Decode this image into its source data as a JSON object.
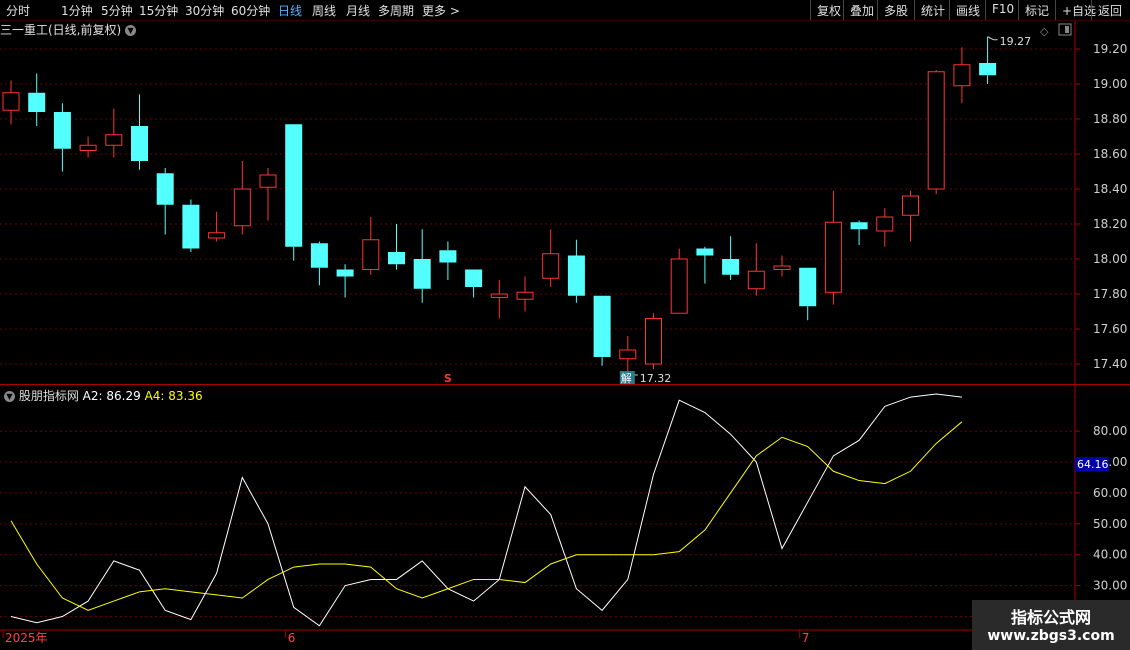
{
  "toolbar": {
    "periods": [
      "分时",
      "1分钟",
      "5分钟",
      "15分钟",
      "30分钟",
      "60分钟",
      "日线",
      "周线",
      "月线",
      "多周期",
      "更多 >"
    ],
    "active_period": "日线",
    "right_buttons": [
      "复权",
      "叠加",
      "多股",
      "统计",
      "画线",
      "F10",
      "标记",
      "+自选",
      "返回"
    ]
  },
  "main_chart": {
    "stock_title": "三一重工(日线,前复权)",
    "toggle_icon": "chevron-down-icon"
  },
  "indicator": {
    "title": "股朋指标网",
    "a2_label": "A2: 86.29",
    "a4_label": "A4: 83.36",
    "current_value_tag": "64.16"
  },
  "watermark": {
    "line1": "指标公式网",
    "line2": "www.zbgs3.com"
  },
  "colors": {
    "up": "#ff3232",
    "down": "#54ffff",
    "grid": "#6a0000",
    "axis": "#aa0000",
    "a2": "#ffffff",
    "a4": "#ffff00",
    "tag_bg": "#0000aa"
  },
  "chart_data": [
    {
      "type": "candlestick",
      "ylim": [
        17.28,
        19.36
      ],
      "yticks": [
        "19.20",
        "19.00",
        "18.80",
        "18.60",
        "18.40",
        "18.20",
        "18.00",
        "17.80",
        "17.60",
        "17.40"
      ],
      "annotations": [
        {
          "text": "19.27",
          "label": "high"
        },
        {
          "text": "17.32",
          "label": "low"
        },
        {
          "text": "S",
          "label": "sell-signal"
        },
        {
          "text": "解",
          "label": "unlock-marker"
        }
      ],
      "candles": [
        {
          "o": 18.85,
          "h": 19.02,
          "l": 18.77,
          "c": 18.95
        },
        {
          "o": 18.95,
          "h": 19.06,
          "l": 18.76,
          "c": 18.84
        },
        {
          "o": 18.84,
          "h": 18.89,
          "l": 18.5,
          "c": 18.63
        },
        {
          "o": 18.62,
          "h": 18.7,
          "l": 18.58,
          "c": 18.65
        },
        {
          "o": 18.65,
          "h": 18.86,
          "l": 18.58,
          "c": 18.71
        },
        {
          "o": 18.76,
          "h": 18.94,
          "l": 18.51,
          "c": 18.56
        },
        {
          "o": 18.49,
          "h": 18.52,
          "l": 18.14,
          "c": 18.31
        },
        {
          "o": 18.31,
          "h": 18.34,
          "l": 18.04,
          "c": 18.06
        },
        {
          "o": 18.12,
          "h": 18.27,
          "l": 18.1,
          "c": 18.15
        },
        {
          "o": 18.19,
          "h": 18.56,
          "l": 18.14,
          "c": 18.4
        },
        {
          "o": 18.41,
          "h": 18.52,
          "l": 18.22,
          "c": 18.48
        },
        {
          "o": 18.77,
          "h": 18.77,
          "l": 17.99,
          "c": 18.07
        },
        {
          "o": 18.09,
          "h": 18.1,
          "l": 17.85,
          "c": 17.95
        },
        {
          "o": 17.94,
          "h": 17.97,
          "l": 17.78,
          "c": 17.9
        },
        {
          "o": 17.94,
          "h": 18.24,
          "l": 17.91,
          "c": 18.11
        },
        {
          "o": 18.04,
          "h": 18.2,
          "l": 17.94,
          "c": 17.97
        },
        {
          "o": 18.0,
          "h": 18.17,
          "l": 17.75,
          "c": 17.83
        },
        {
          "o": 18.05,
          "h": 18.1,
          "l": 17.88,
          "c": 17.98
        },
        {
          "o": 17.94,
          "h": 17.94,
          "l": 17.78,
          "c": 17.84
        },
        {
          "o": 17.78,
          "h": 17.88,
          "l": 17.66,
          "c": 17.8
        },
        {
          "o": 17.77,
          "h": 17.9,
          "l": 17.7,
          "c": 17.81
        },
        {
          "o": 17.89,
          "h": 18.17,
          "l": 17.84,
          "c": 18.03
        },
        {
          "o": 18.02,
          "h": 18.11,
          "l": 17.75,
          "c": 17.79
        },
        {
          "o": 17.79,
          "h": 17.79,
          "l": 17.39,
          "c": 17.44
        },
        {
          "o": 17.43,
          "h": 17.56,
          "l": 17.32,
          "c": 17.48
        },
        {
          "o": 17.4,
          "h": 17.69,
          "l": 17.37,
          "c": 17.66
        },
        {
          "o": 17.69,
          "h": 18.06,
          "l": 17.69,
          "c": 18.0
        },
        {
          "o": 18.06,
          "h": 18.07,
          "l": 17.86,
          "c": 18.02
        },
        {
          "o": 18.0,
          "h": 18.13,
          "l": 17.88,
          "c": 17.91
        },
        {
          "o": 17.83,
          "h": 18.09,
          "l": 17.79,
          "c": 17.93
        },
        {
          "o": 17.94,
          "h": 18.02,
          "l": 17.9,
          "c": 17.96
        },
        {
          "o": 17.95,
          "h": 17.95,
          "l": 17.65,
          "c": 17.73
        },
        {
          "o": 17.81,
          "h": 18.39,
          "l": 17.74,
          "c": 18.21
        },
        {
          "o": 18.21,
          "h": 18.22,
          "l": 18.08,
          "c": 18.17
        },
        {
          "o": 18.16,
          "h": 18.29,
          "l": 18.07,
          "c": 18.24
        },
        {
          "o": 18.25,
          "h": 18.39,
          "l": 18.1,
          "c": 18.36
        },
        {
          "o": 18.4,
          "h": 19.08,
          "l": 18.37,
          "c": 19.07
        },
        {
          "o": 18.99,
          "h": 19.21,
          "l": 18.89,
          "c": 19.11
        },
        {
          "o": 19.12,
          "h": 19.27,
          "l": 19.0,
          "c": 19.05
        }
      ]
    },
    {
      "type": "line",
      "ylim": [
        15,
        92
      ],
      "yticks": [
        "80.00",
        "70.00",
        "60.00",
        "50.00",
        "40.00",
        "30.00",
        "20.00"
      ],
      "x_labels": [
        {
          "text": "2025年",
          "index": 0
        },
        {
          "text": "6",
          "index": 11
        },
        {
          "text": "7",
          "index": 31
        }
      ],
      "series": [
        {
          "name": "A2",
          "values": [
            20,
            18,
            20,
            25,
            38,
            35,
            22,
            19,
            34,
            65,
            50,
            23,
            17,
            30,
            32,
            32,
            38,
            29,
            25,
            32,
            62,
            53,
            29,
            22,
            32,
            66,
            90,
            86,
            79,
            70,
            42,
            57,
            72,
            77,
            88,
            91,
            92,
            91
          ]
        },
        {
          "name": "A4",
          "values": [
            51,
            37,
            26,
            22,
            25,
            28,
            29,
            28,
            27,
            26,
            32,
            36,
            37,
            37,
            36,
            29,
            26,
            29,
            32,
            32,
            31,
            37,
            40,
            40,
            40,
            40,
            41,
            48,
            60,
            72,
            78,
            75,
            67,
            64,
            63,
            67,
            76,
            83
          ]
        }
      ]
    }
  ]
}
